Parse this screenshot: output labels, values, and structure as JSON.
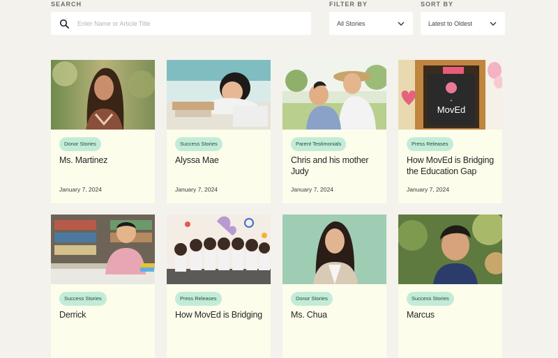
{
  "filters": {
    "search_label": "SEARCH",
    "search_placeholder": "Enter Name or Article Title",
    "filter_label": "FILTER BY",
    "filter_value": "All Stories",
    "sort_label": "SORT BY",
    "sort_value": "Latest to Oldest"
  },
  "cards": [
    {
      "tag": "Donor Stories",
      "title": "Ms. Martinez",
      "date": "January 7, 2024"
    },
    {
      "tag": "Success Stories",
      "title": "Alyssa Mae",
      "date": "January 7, 2024"
    },
    {
      "tag": "Parent Testimonials",
      "title": "Chris and his mother Judy",
      "date": "January 7, 2024"
    },
    {
      "tag": "Press Releases",
      "title": "How MovEd is Bridging the Education Gap",
      "date": "January 7, 2024"
    },
    {
      "tag": "Success Stories",
      "title": "Derrick",
      "date": ""
    },
    {
      "tag": "Press Releases",
      "title": "How MovEd is Bridging",
      "date": ""
    },
    {
      "tag": "Donor Stories",
      "title": "Ms. Chua",
      "date": ""
    },
    {
      "tag": "Success Stories",
      "title": "Marcus",
      "date": ""
    }
  ],
  "image_text": {
    "board_word": "MovEd"
  },
  "colors": {
    "background": "#f3f2ec",
    "card": "#fdfdec",
    "tag": "#c3ecd8"
  }
}
